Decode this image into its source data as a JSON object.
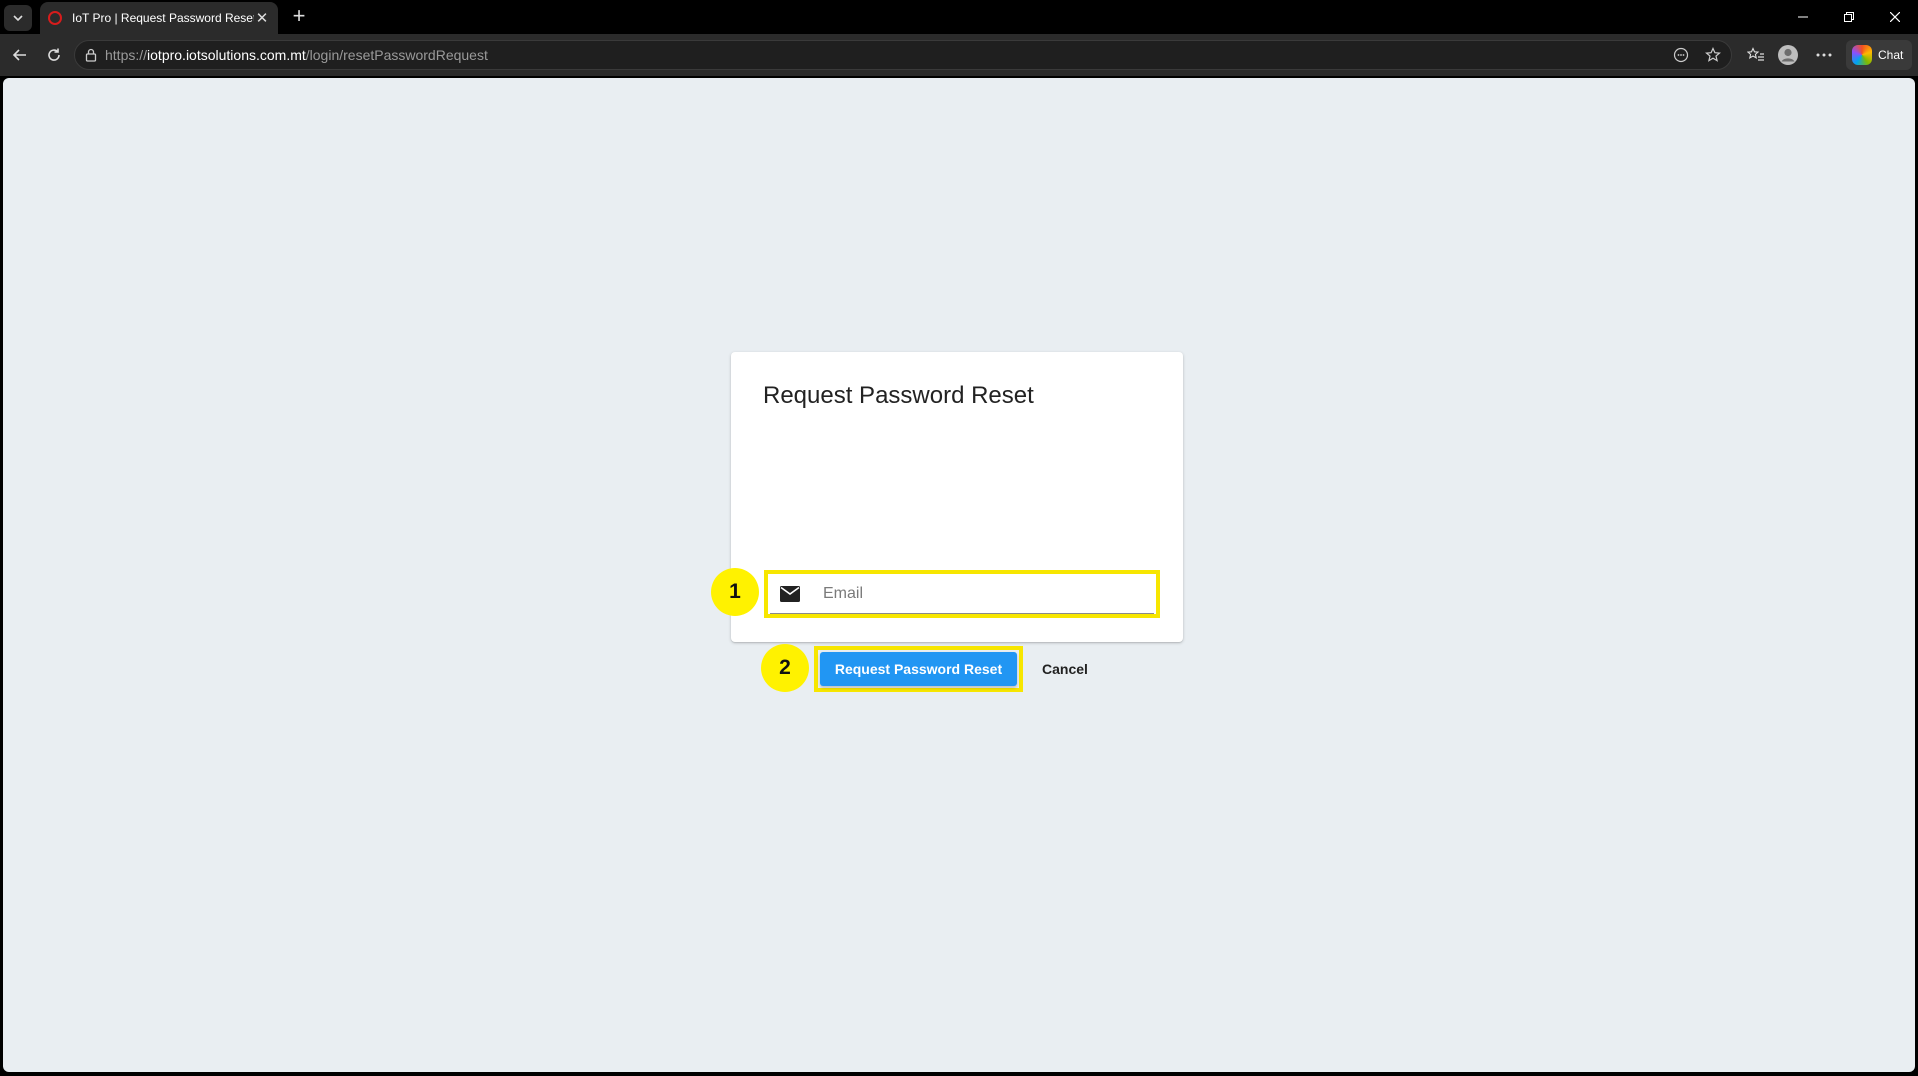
{
  "browser": {
    "tab_title": "IoT Pro | Request Password Reset",
    "url_scheme": "https://",
    "url_domain": "iotpro.iotsolutions.com.mt",
    "url_path": "/login/resetPasswordRequest",
    "chat_label": "Chat"
  },
  "page": {
    "title": "Request Password Reset",
    "email_placeholder": "Email",
    "email_value": "",
    "submit_label": "Request Password Reset",
    "cancel_label": "Cancel"
  },
  "annotations": {
    "step_1": "1",
    "step_2": "2",
    "highlight_color": "#f7e600"
  },
  "colors": {
    "primary_button": "#2196f3",
    "page_background": "#e9eef2"
  }
}
